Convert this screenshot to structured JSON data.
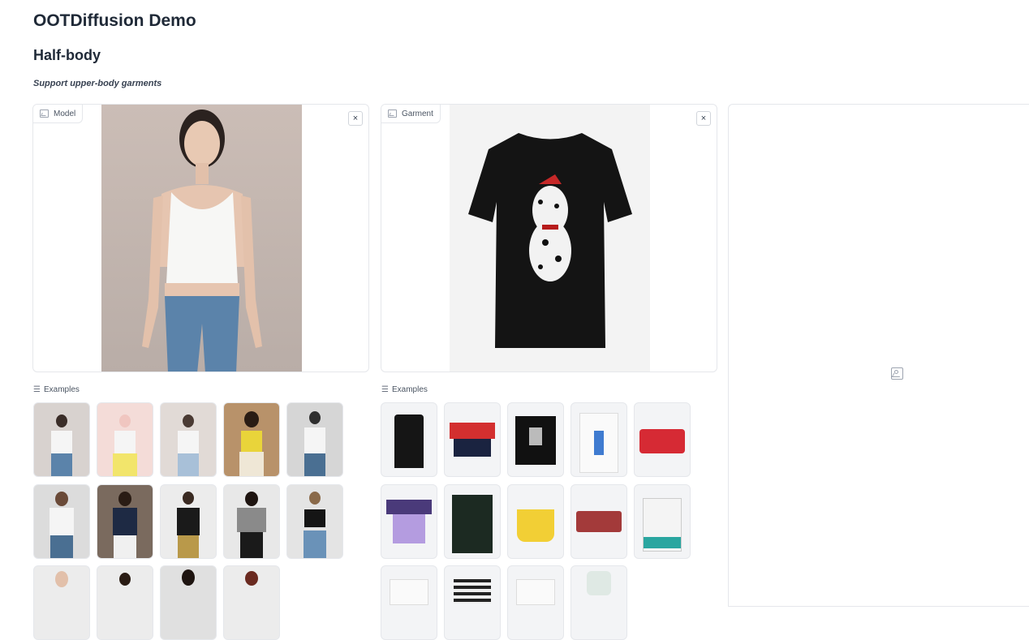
{
  "title": "OOTDiffusion Demo",
  "section": "Half-body",
  "subtitle": "Support upper-body garments",
  "model_panel": {
    "label": "Model",
    "close": "×"
  },
  "garment_panel": {
    "label": "Garment",
    "close": "×"
  },
  "examples_label": "Examples",
  "colors": {
    "border": "#e5e7eb",
    "text": "#1f2937",
    "muted": "#4b5563"
  }
}
